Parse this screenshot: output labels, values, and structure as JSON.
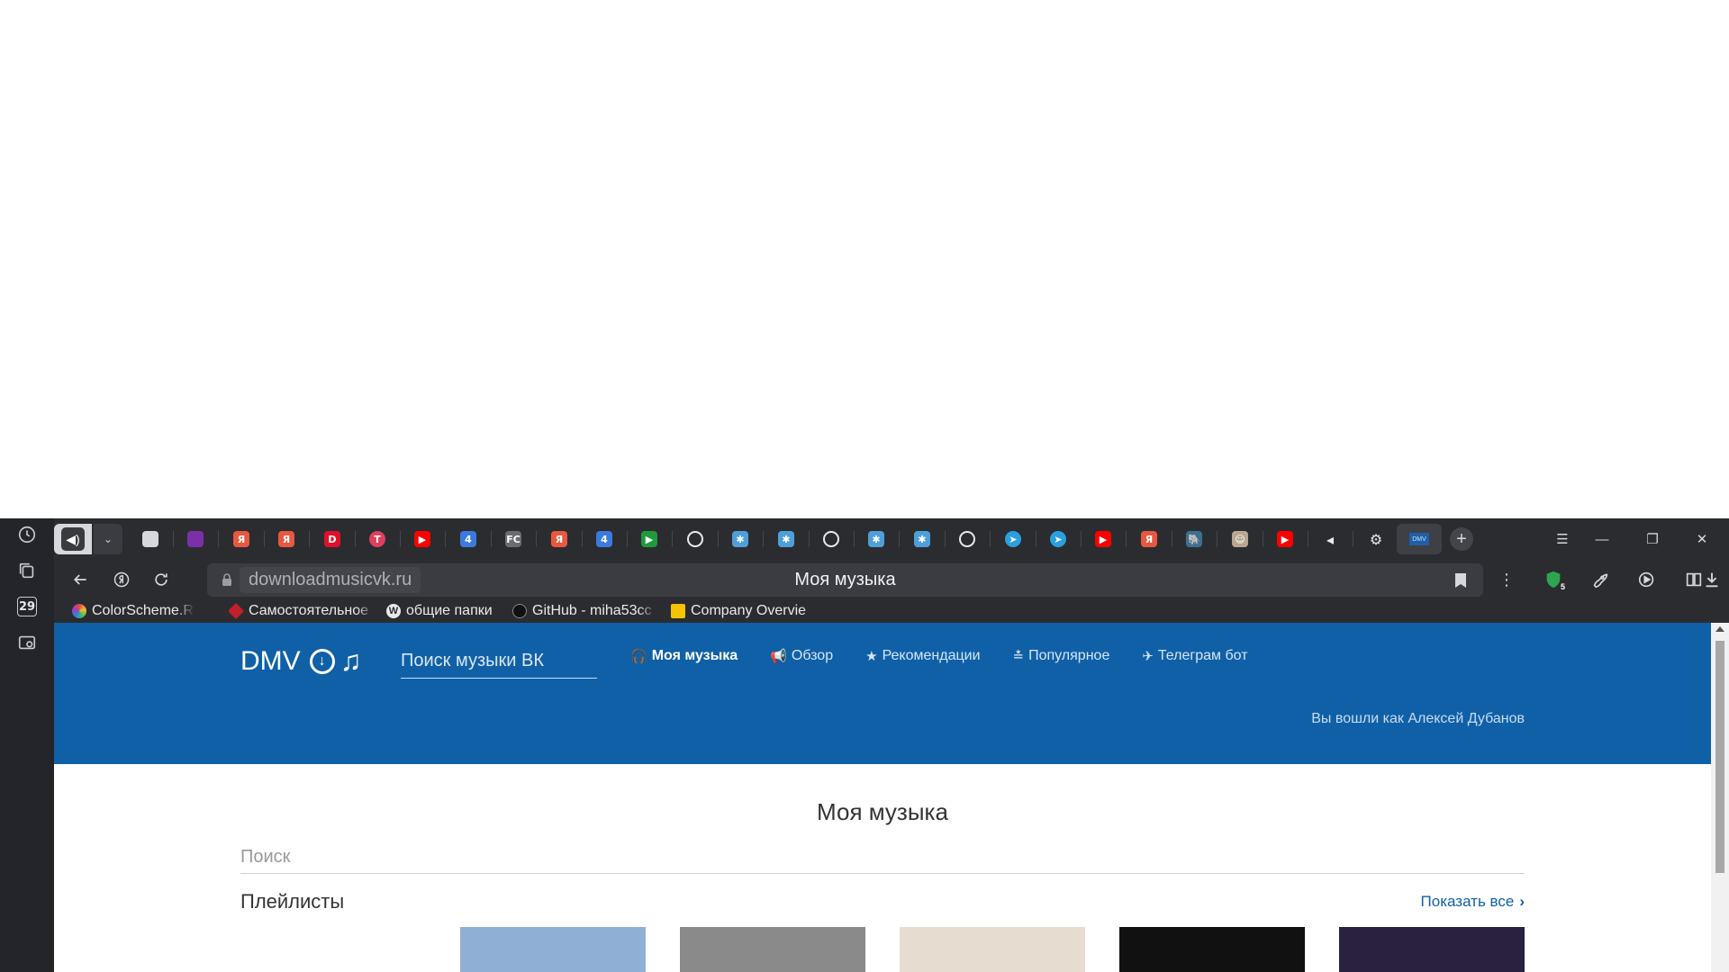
{
  "browser": {
    "side_panel": {
      "calendar_day": "29"
    },
    "tabs": {
      "active_tab_label": "DMV",
      "pinned": [
        {
          "icon": "document-icon",
          "color": "#d7d8dc",
          "glyph": ""
        },
        {
          "icon": "podcast-icon",
          "color": "#7b2fa8",
          "glyph": ""
        },
        {
          "icon": "yandex-icon",
          "color": "#e8573f",
          "glyph": "Я"
        },
        {
          "icon": "yandex-icon",
          "color": "#e8573f",
          "glyph": "Я"
        },
        {
          "icon": "d-red-icon",
          "color": "#e0102a",
          "glyph": "D"
        },
        {
          "icon": "t-circle-icon",
          "color": "#e0405a",
          "glyph": "T"
        },
        {
          "icon": "youtube-icon",
          "color": "#ff0000",
          "glyph": "▶"
        },
        {
          "icon": "four-icon",
          "color": "#3b7be0",
          "glyph": "4"
        },
        {
          "icon": "fc-icon",
          "color": "#6b6c72",
          "glyph": "FC"
        },
        {
          "icon": "yandex-icon",
          "color": "#e8573f",
          "glyph": "Я"
        },
        {
          "icon": "four-icon",
          "color": "#3b7be0",
          "glyph": "4"
        },
        {
          "icon": "green-flag-icon",
          "color": "#1f9a3a",
          "glyph": "▶"
        },
        {
          "icon": "github-icon",
          "color": "#e9eaec",
          "glyph": ""
        },
        {
          "icon": "frame-icon",
          "color": "#4f9fd8",
          "glyph": "✱"
        },
        {
          "icon": "frame-icon",
          "color": "#4f9fd8",
          "glyph": "✱"
        },
        {
          "icon": "github-icon",
          "color": "#e9eaec",
          "glyph": ""
        },
        {
          "icon": "frame-icon",
          "color": "#4f9fd8",
          "glyph": "✱"
        },
        {
          "icon": "frame-icon",
          "color": "#4f9fd8",
          "glyph": "✱"
        },
        {
          "icon": "github-icon",
          "color": "#e9eaec",
          "glyph": ""
        },
        {
          "icon": "telegram-icon",
          "color": "#2aa0e0",
          "glyph": "➤"
        },
        {
          "icon": "telegram-icon",
          "color": "#2aa0e0",
          "glyph": "➤"
        },
        {
          "icon": "youtube-icon",
          "color": "#ff0000",
          "glyph": "▶"
        },
        {
          "icon": "yandex-icon",
          "color": "#e8573f",
          "glyph": "Я"
        },
        {
          "icon": "elephant-icon",
          "color": "#3d6f8f",
          "glyph": "🐘"
        },
        {
          "icon": "avatar-icon",
          "color": "#b8a890",
          "glyph": "☺"
        },
        {
          "icon": "youtube-icon",
          "color": "#ff0000",
          "glyph": "▶"
        },
        {
          "icon": "speaker-icon",
          "color": "#2b2c30",
          "glyph": "◂"
        },
        {
          "icon": "gear-icon",
          "color": "#2b2c30",
          "glyph": "⚙"
        }
      ]
    },
    "omnibox": {
      "host": "downloadmusicvk.ru",
      "title": "Моя музыка",
      "shield_badge": "5"
    },
    "bookmarks": [
      {
        "label": "ColorScheme.Ru –",
        "icon": "colorwheel-icon",
        "color": "#e04848"
      },
      {
        "label": "Самостоятельное",
        "icon": "diamond-icon",
        "color": "#c0202a"
      },
      {
        "label": "общие папки",
        "icon": "wordpress-icon",
        "color": "#e9eaec"
      },
      {
        "label": "GitHub - miha53cc",
        "icon": "github-icon",
        "color": "#1a1a1a"
      },
      {
        "label": "Company Overvie",
        "icon": "chart-icon",
        "color": "#f5c400"
      }
    ]
  },
  "site": {
    "logo_text": "DMV",
    "search_placeholder": "Поиск музыки ВК",
    "nav": [
      {
        "label": "Моя музыка",
        "icon": "headphones-icon",
        "glyph": "🎧",
        "active": true
      },
      {
        "label": "Обзор",
        "icon": "megaphone-icon",
        "glyph": "◀)",
        "active": false
      },
      {
        "label": "Рекомендации",
        "icon": "star-icon",
        "glyph": "★",
        "active": false
      },
      {
        "label": "Популярное",
        "icon": "podium-icon",
        "glyph": "≛",
        "active": false
      },
      {
        "label": "Телеграм бот",
        "icon": "paper-plane-icon",
        "glyph": "✈",
        "active": false
      }
    ],
    "logged_in_text": "Вы вошли как Алексей Дубанов",
    "page_title": "Моя музыка",
    "content_search_placeholder": "Поиск",
    "playlists_title": "Плейлисты",
    "show_all_label": "Показать все",
    "playlist_covers": [
      "#ffffff",
      "#8fb0d4",
      "#8a8a8a",
      "#e6ddd0",
      "#111111",
      "#2a2040"
    ]
  },
  "colors": {
    "header_blue": "#1060a8",
    "browser_dark": "#2b2c30"
  }
}
